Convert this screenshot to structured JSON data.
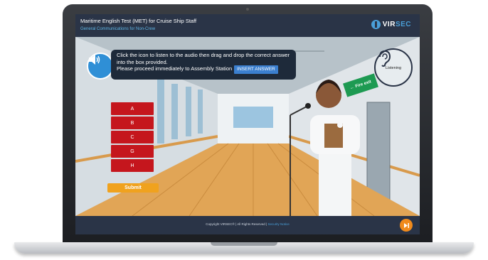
{
  "header": {
    "title": "Maritime English Test (MET) for Cruise Ship Staff",
    "subtitle": "General Communications for Non-Crew",
    "logo_text": "VIR",
    "logo_text_accent": "SEC"
  },
  "instruction": {
    "line1": "Click the icon to listen to the audio then drag and drop the correct answer into the box provided.",
    "line2": "Please proceed immediately to Assembly Station",
    "drop_target": "INSERT ANSWER"
  },
  "answers": [
    "A",
    "B",
    "C",
    "G",
    "H"
  ],
  "submit_label": "Submit",
  "listening_label": "Listening",
  "exit_sign": "Fire exit",
  "footer": {
    "copyright": "Copyright VIRSEC® | All Rights Reserved |",
    "link": "Security Notice"
  },
  "colors": {
    "accent": "#2f8fd6",
    "answer_bg": "#c5161d",
    "submit_bg": "#f0a21e",
    "header_bg": "#2a3447"
  }
}
